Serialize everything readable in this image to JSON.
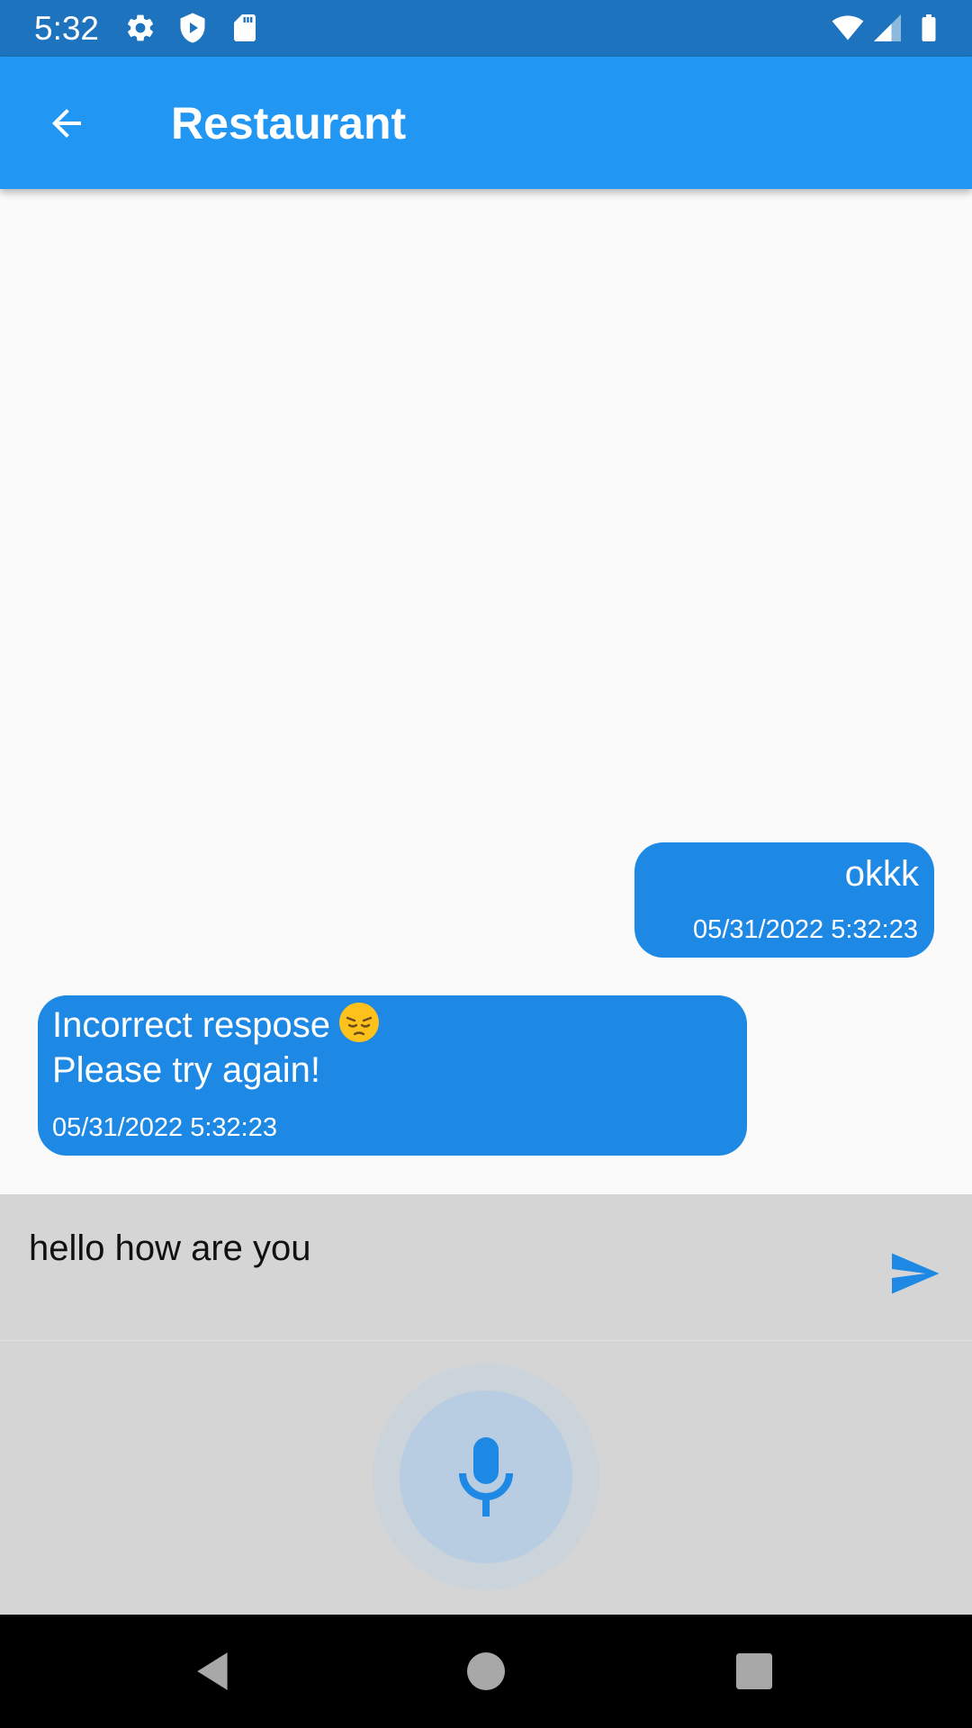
{
  "status_bar": {
    "time": "5:32",
    "icons": [
      "gear-icon",
      "shield-play-icon",
      "sd-card-icon",
      "wifi-icon",
      "cell-signal-icon",
      "battery-icon"
    ]
  },
  "app_bar": {
    "title": "Restaurant",
    "back_icon": "arrow-back-icon",
    "color": "#2196f3"
  },
  "messages": [
    {
      "sender": "user",
      "text": "okkk",
      "timestamp": "05/31/2022 5:32:23"
    },
    {
      "sender": "bot",
      "line1": "Incorrect respose",
      "emoji": "pensive-face-emoji",
      "line2": "Please try again!",
      "timestamp": "05/31/2022 5:32:23"
    }
  ],
  "input": {
    "value": "hello how are you",
    "send_icon": "send-icon"
  },
  "mic": {
    "icon": "microphone-icon"
  },
  "nav_bar": {
    "icons": [
      "back-triangle-icon",
      "home-circle-icon",
      "recents-square-icon"
    ]
  },
  "colors": {
    "status_bar": "#1d73bd",
    "bubble": "#1e88e5",
    "accent": "#2196f3",
    "input_bg": "#d5d5d5"
  }
}
